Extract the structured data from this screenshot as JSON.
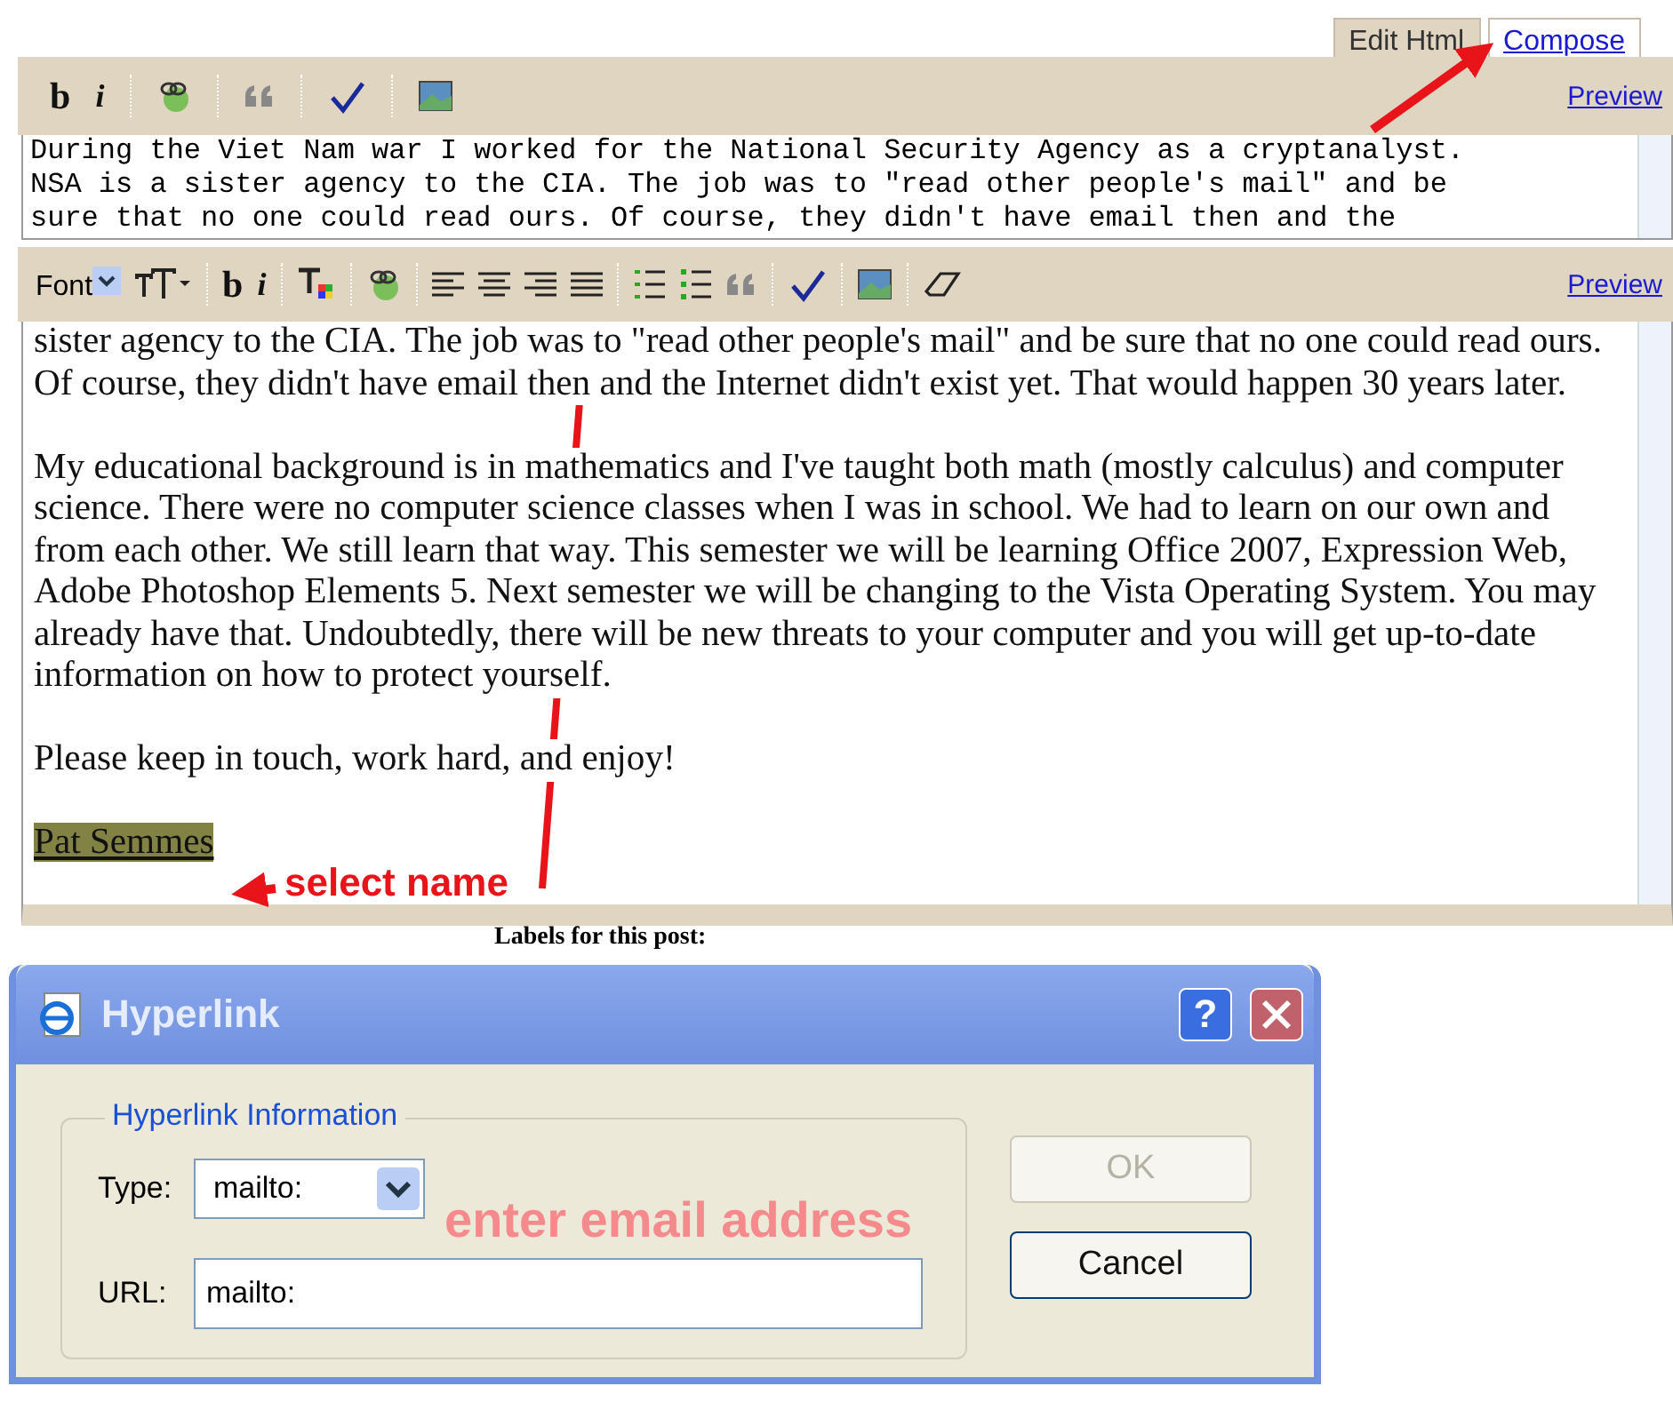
{
  "top_editor": {
    "tabs": [
      {
        "label": "Edit Html",
        "selected": true
      },
      {
        "label": "Compose",
        "selected": false
      }
    ],
    "bold": "b",
    "italic": "i",
    "preview_link": "Preview",
    "text_lines": [
      "During the Viet Nam war I worked for the National Security Agency as a cryptanalyst.",
      "NSA is a sister agency to the CIA. The job was to \"read other people's mail\" and be",
      "sure that no one could read ours. Of course, they didn't have email then and the"
    ]
  },
  "main_editor": {
    "font_select": "Font",
    "bold": "b",
    "italic": "i",
    "preview_link": "Preview",
    "paragraphs": [
      "sister agency to the CIA. The job was to \"read other people's mail\" and be sure that no one could read ours. Of course, they didn't have email then and the Internet didn't exist yet. That would happen 30 years later.",
      "My educational background is in mathematics and I've taught both math (mostly calculus) and computer science. There were no computer science classes when I was in school. We had to learn on our own and from each other. We still learn that way. This semester we will be learning Office 2007, Expression Web, Adobe Photoshop Elements 5. Next semester we will be changing to the Vista Operating System. You may already have that. Undoubtedly, there will be new threats to your computer and you will get up-to-date information on how to protect yourself.",
      "Please keep in touch, work hard, and enjoy!"
    ],
    "selected_name": "Pat Semmes"
  },
  "labels_caption": "Labels for this post:",
  "dialog": {
    "title": "Hyperlink",
    "help_button": "?",
    "group_title": "Hyperlink Information",
    "type_label": "Type:",
    "type_value": "mailto:",
    "url_label": "URL:",
    "url_value": "mailto:",
    "buttons": [
      {
        "label": "OK",
        "disabled": true
      },
      {
        "label": "Cancel",
        "disabled": false
      }
    ]
  },
  "annotations": [
    {
      "text": "select name"
    },
    {
      "text": "enter email address"
    }
  ]
}
